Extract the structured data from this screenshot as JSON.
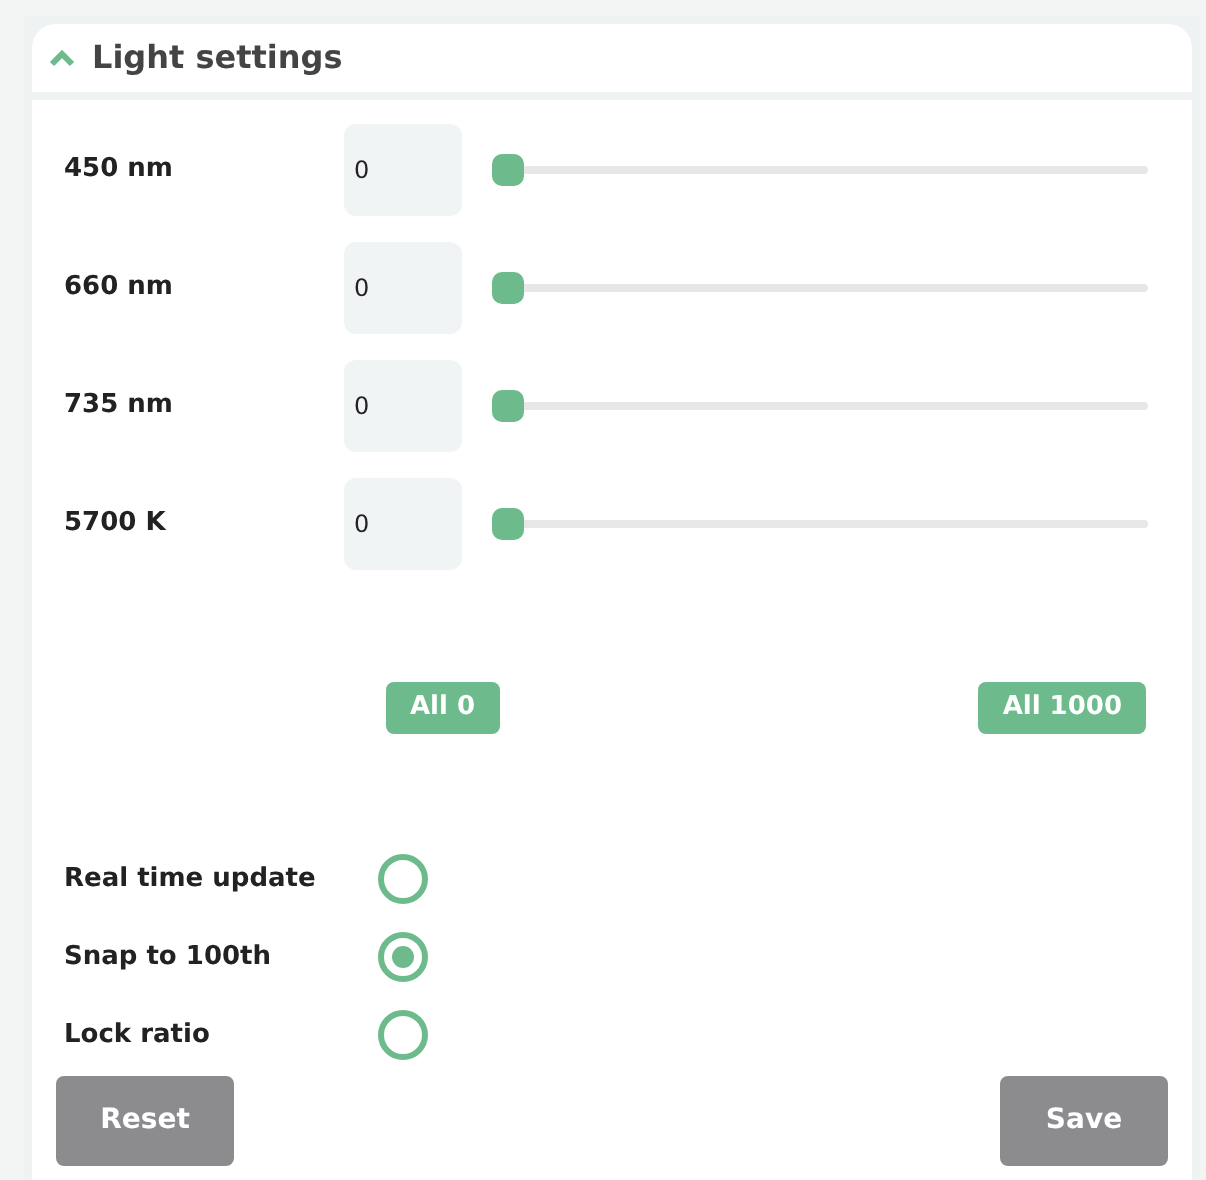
{
  "panel": {
    "title": "Light settings",
    "expanded": true
  },
  "channels": [
    {
      "name": "450 nm",
      "value": "0",
      "level": 0
    },
    {
      "name": "660 nm",
      "value": "0",
      "level": 0
    },
    {
      "name": "735 nm",
      "value": "0",
      "level": 0
    },
    {
      "name": "5700 K",
      "value": "0",
      "level": 0
    }
  ],
  "bulk_buttons": [
    "All 0",
    "All 1000"
  ],
  "options": [
    {
      "label": "Real time update",
      "selected": false
    },
    {
      "label": "Snap to 100th",
      "selected": true
    },
    {
      "label": "Lock ratio",
      "selected": false
    }
  ],
  "buttons": [
    "Reset",
    "Save"
  ]
}
